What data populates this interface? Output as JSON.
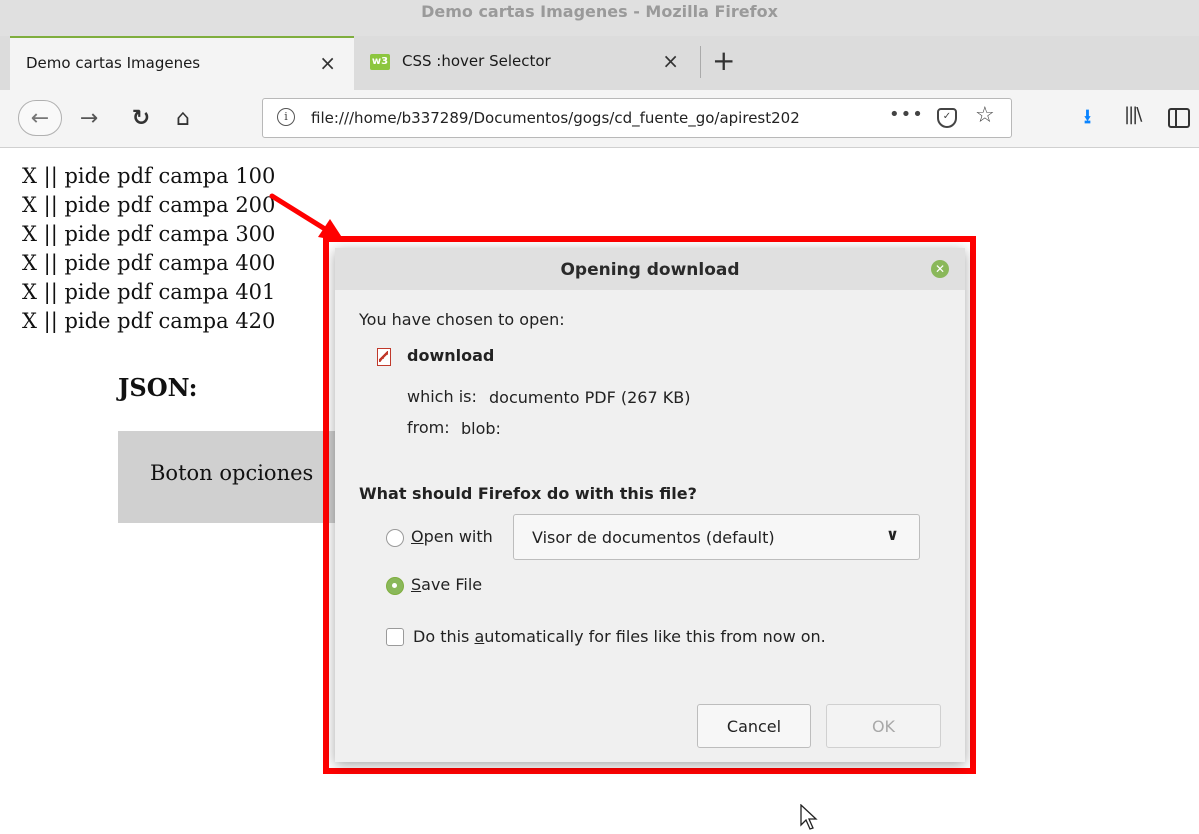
{
  "window": {
    "title": "Demo cartas Imagenes - Mozilla Firefox"
  },
  "tabs": [
    {
      "label": "Demo cartas Imagenes",
      "active": true
    },
    {
      "label": "CSS :hover Selector",
      "active": false,
      "favicon": "w3"
    }
  ],
  "tab_close_glyph": "×",
  "new_tab_glyph": "+",
  "navbar": {
    "url": "file:///home/b337289/Documentos/gogs/cd_fuente_go/apirest202",
    "page_actions": "•••"
  },
  "page": {
    "lines": [
      "X || pide pdf campa 100",
      "X || pide pdf campa 200",
      "X || pide pdf campa 300",
      "X || pide pdf campa 400",
      "X || pide pdf campa 401",
      "X || pide pdf campa 420"
    ],
    "json_heading": "JSON:",
    "options_button": "Boton opciones"
  },
  "dialog": {
    "title": "Opening download",
    "chosen_label": "You have chosen to open:",
    "file_name": "download",
    "which_label": "which is:",
    "which_value": "documento PDF (267 KB)",
    "from_label": "from:",
    "from_value": "blob:",
    "question": "What should Firefox do with this file?",
    "open_with": {
      "mnemonic": "O",
      "rest": "pen with",
      "selected": false
    },
    "app_select_value": "Visor de documentos (default)",
    "save_file": {
      "mnemonic": "S",
      "rest": "ave File",
      "selected": true
    },
    "auto": {
      "before": "Do this ",
      "mnemonic": "a",
      "after": "utomatically for files like this from now on.",
      "checked": false
    },
    "cancel_label": "Cancel",
    "ok_label": "OK"
  },
  "colors": {
    "highlight": "#ff0000",
    "radio_selected": "#8ab85a",
    "download_icon": "#0a84ff"
  }
}
